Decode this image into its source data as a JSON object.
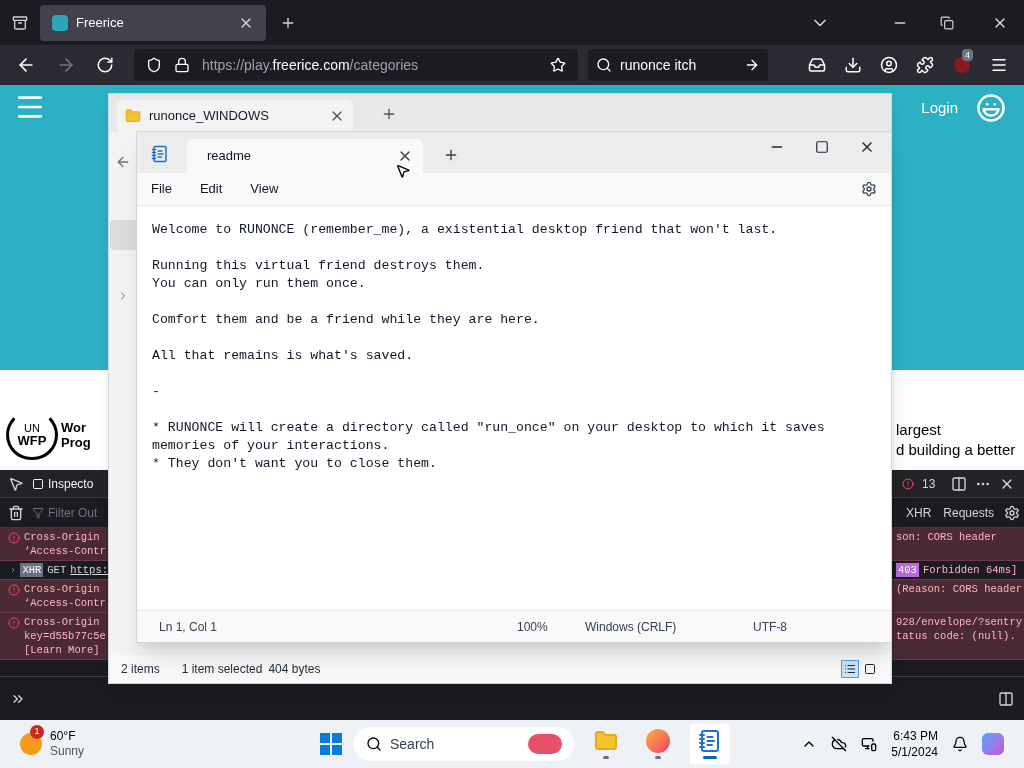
{
  "browser": {
    "tabs": [
      {
        "title": "Freerice",
        "selected": true
      }
    ],
    "url": {
      "prefix": "https://play.",
      "domain": "freerice.com",
      "path": "/categories"
    },
    "search": {
      "value": "runonce itch"
    },
    "extension_badge": "4"
  },
  "page": {
    "login": "Login",
    "logo": {
      "un": "UN",
      "wfp": "WFP",
      "name_lines": [
        "Wor",
        "Prog"
      ]
    },
    "text_lines": [
      "largest",
      "d building a better"
    ]
  },
  "devtools": {
    "tabs": [
      {
        "label": "Inspecto",
        "selected": true
      }
    ],
    "filter_placeholder": "Filter Out",
    "error_count": "13",
    "filters": [
      {
        "label": "XHR",
        "selected": false
      },
      {
        "label": "Requests",
        "selected": false
      }
    ],
    "rows": [
      {
        "kind": "error",
        "left": [
          "Cross-Origin",
          "‘Access-Contr"
        ],
        "right": [
          "son: CORS header"
        ]
      },
      {
        "kind": "xhr",
        "badge": "XHR",
        "method": "GET",
        "url": "https:",
        "status": "403",
        "right": [
          "Forbidden 64ms]"
        ]
      },
      {
        "kind": "error",
        "left": [
          "Cross-Origin",
          "‘Access-Contr"
        ],
        "right": [
          "(Reason: CORS header"
        ]
      },
      {
        "kind": "error",
        "left": [
          "Cross-Origin",
          "key=d55b77c5e",
          "[Learn More]"
        ],
        "right": [
          "928/envelope/?sentry",
          "tatus code: (null)."
        ]
      }
    ]
  },
  "explorer": {
    "tab": "runonce_WINDOWS",
    "status": {
      "count": "2 items",
      "selection": "1 item selected",
      "size": "404 bytes"
    },
    "views": [
      {
        "kind": "details",
        "selected": true
      },
      {
        "kind": "tiles",
        "selected": false
      }
    ]
  },
  "notepad": {
    "tab": "readme",
    "menu": [
      "File",
      "Edit",
      "View"
    ],
    "paragraphs": [
      [
        "Welcome to RUNONCE (remember_me), a existential desktop friend that won't last."
      ],
      [
        "Running this virtual friend destroys them.",
        "You can only run them once."
      ],
      [
        "Comfort them and be a friend while they are here."
      ],
      [
        "All that remains is what's saved."
      ],
      [
        "-"
      ],
      [
        "* RUNONCE will create a directory called \"run_once\" on your desktop to which it saves",
        "memories of your interactions.",
        "* They don't want you to close them."
      ]
    ],
    "status": [
      "Ln 1, Col 1",
      "100%",
      "Windows (CRLF)",
      "UTF-8"
    ]
  },
  "taskbar": {
    "weather": {
      "badge": "1",
      "temp": "60°F",
      "condition": "Sunny"
    },
    "search_placeholder": "Search",
    "apps": [
      {
        "kind": "explorer",
        "active": false
      },
      {
        "kind": "firefox",
        "active": false
      },
      {
        "kind": "notepad",
        "active": true
      }
    ],
    "time": "6:43 PM",
    "date": "5/1/2024"
  }
}
